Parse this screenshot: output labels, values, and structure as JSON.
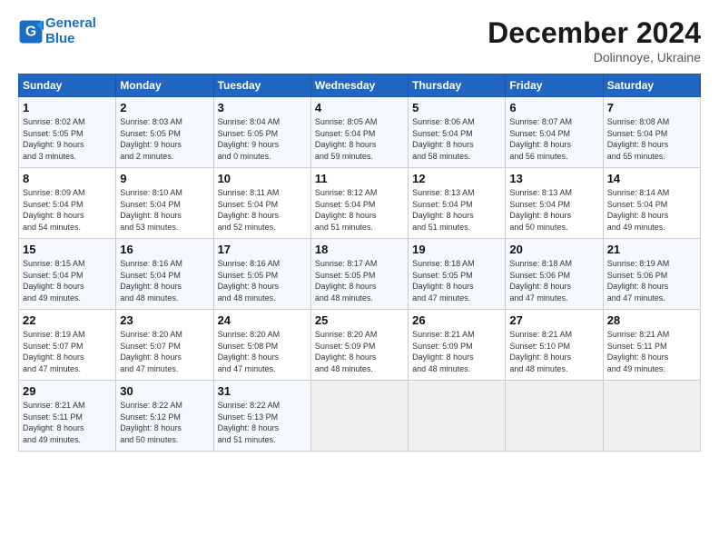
{
  "header": {
    "logo_line1": "General",
    "logo_line2": "Blue",
    "month": "December 2024",
    "location": "Dolinnoye, Ukraine"
  },
  "days_of_week": [
    "Sunday",
    "Monday",
    "Tuesday",
    "Wednesday",
    "Thursday",
    "Friday",
    "Saturday"
  ],
  "weeks": [
    [
      {
        "day": 1,
        "sunrise": "8:02 AM",
        "sunset": "5:05 PM",
        "daylight": "9 hours and 3 minutes."
      },
      {
        "day": 2,
        "sunrise": "8:03 AM",
        "sunset": "5:05 PM",
        "daylight": "9 hours and 2 minutes."
      },
      {
        "day": 3,
        "sunrise": "8:04 AM",
        "sunset": "5:05 PM",
        "daylight": "9 hours and 0 minutes."
      },
      {
        "day": 4,
        "sunrise": "8:05 AM",
        "sunset": "5:04 PM",
        "daylight": "8 hours and 59 minutes."
      },
      {
        "day": 5,
        "sunrise": "8:06 AM",
        "sunset": "5:04 PM",
        "daylight": "8 hours and 58 minutes."
      },
      {
        "day": 6,
        "sunrise": "8:07 AM",
        "sunset": "5:04 PM",
        "daylight": "8 hours and 56 minutes."
      },
      {
        "day": 7,
        "sunrise": "8:08 AM",
        "sunset": "5:04 PM",
        "daylight": "8 hours and 55 minutes."
      }
    ],
    [
      {
        "day": 8,
        "sunrise": "8:09 AM",
        "sunset": "5:04 PM",
        "daylight": "8 hours and 54 minutes."
      },
      {
        "day": 9,
        "sunrise": "8:10 AM",
        "sunset": "5:04 PM",
        "daylight": "8 hours and 53 minutes."
      },
      {
        "day": 10,
        "sunrise": "8:11 AM",
        "sunset": "5:04 PM",
        "daylight": "8 hours and 52 minutes."
      },
      {
        "day": 11,
        "sunrise": "8:12 AM",
        "sunset": "5:04 PM",
        "daylight": "8 hours and 51 minutes."
      },
      {
        "day": 12,
        "sunrise": "8:13 AM",
        "sunset": "5:04 PM",
        "daylight": "8 hours and 51 minutes."
      },
      {
        "day": 13,
        "sunrise": "8:13 AM",
        "sunset": "5:04 PM",
        "daylight": "8 hours and 50 minutes."
      },
      {
        "day": 14,
        "sunrise": "8:14 AM",
        "sunset": "5:04 PM",
        "daylight": "8 hours and 49 minutes."
      }
    ],
    [
      {
        "day": 15,
        "sunrise": "8:15 AM",
        "sunset": "5:04 PM",
        "daylight": "8 hours and 49 minutes."
      },
      {
        "day": 16,
        "sunrise": "8:16 AM",
        "sunset": "5:04 PM",
        "daylight": "8 hours and 48 minutes."
      },
      {
        "day": 17,
        "sunrise": "8:16 AM",
        "sunset": "5:05 PM",
        "daylight": "8 hours and 48 minutes."
      },
      {
        "day": 18,
        "sunrise": "8:17 AM",
        "sunset": "5:05 PM",
        "daylight": "8 hours and 48 minutes."
      },
      {
        "day": 19,
        "sunrise": "8:18 AM",
        "sunset": "5:05 PM",
        "daylight": "8 hours and 47 minutes."
      },
      {
        "day": 20,
        "sunrise": "8:18 AM",
        "sunset": "5:06 PM",
        "daylight": "8 hours and 47 minutes."
      },
      {
        "day": 21,
        "sunrise": "8:19 AM",
        "sunset": "5:06 PM",
        "daylight": "8 hours and 47 minutes."
      }
    ],
    [
      {
        "day": 22,
        "sunrise": "8:19 AM",
        "sunset": "5:07 PM",
        "daylight": "8 hours and 47 minutes."
      },
      {
        "day": 23,
        "sunrise": "8:20 AM",
        "sunset": "5:07 PM",
        "daylight": "8 hours and 47 minutes."
      },
      {
        "day": 24,
        "sunrise": "8:20 AM",
        "sunset": "5:08 PM",
        "daylight": "8 hours and 47 minutes."
      },
      {
        "day": 25,
        "sunrise": "8:20 AM",
        "sunset": "5:09 PM",
        "daylight": "8 hours and 48 minutes."
      },
      {
        "day": 26,
        "sunrise": "8:21 AM",
        "sunset": "5:09 PM",
        "daylight": "8 hours and 48 minutes."
      },
      {
        "day": 27,
        "sunrise": "8:21 AM",
        "sunset": "5:10 PM",
        "daylight": "8 hours and 48 minutes."
      },
      {
        "day": 28,
        "sunrise": "8:21 AM",
        "sunset": "5:11 PM",
        "daylight": "8 hours and 49 minutes."
      }
    ],
    [
      {
        "day": 29,
        "sunrise": "8:21 AM",
        "sunset": "5:11 PM",
        "daylight": "8 hours and 49 minutes."
      },
      {
        "day": 30,
        "sunrise": "8:22 AM",
        "sunset": "5:12 PM",
        "daylight": "8 hours and 50 minutes."
      },
      {
        "day": 31,
        "sunrise": "8:22 AM",
        "sunset": "5:13 PM",
        "daylight": "8 hours and 51 minutes."
      },
      null,
      null,
      null,
      null
    ]
  ]
}
